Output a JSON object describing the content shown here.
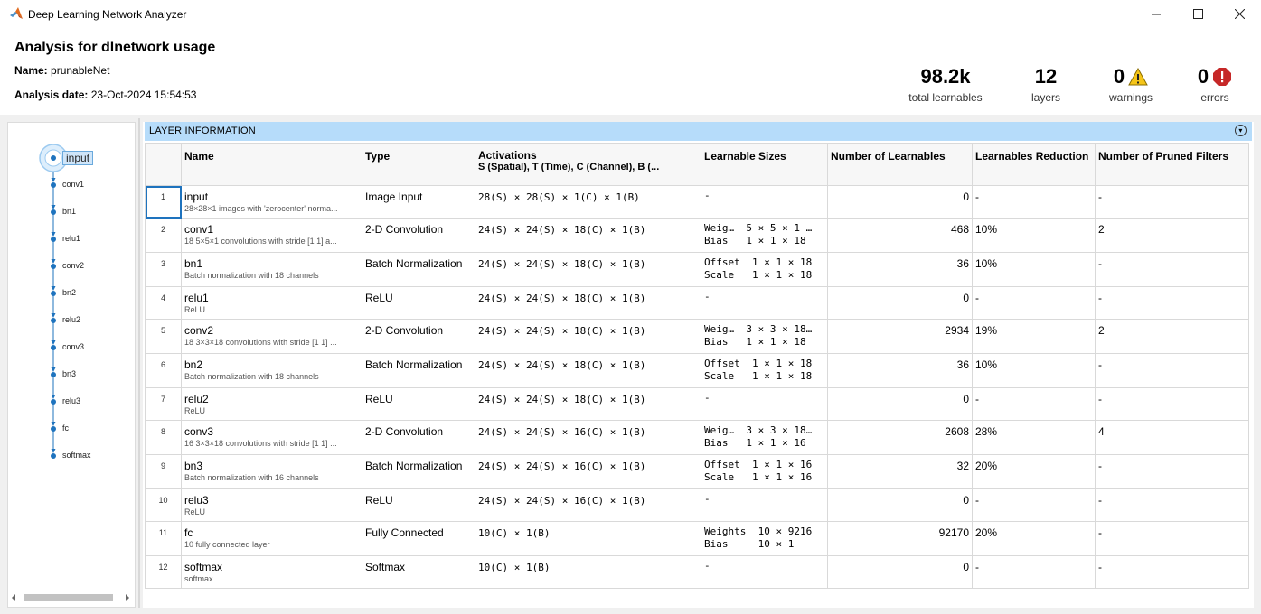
{
  "window": {
    "title": "Deep Learning Network Analyzer"
  },
  "summary": {
    "title": "Analysis for dlnetwork usage",
    "name_label": "Name:",
    "name_value": "prunableNet",
    "date_label": "Analysis date:",
    "date_value": "23-Oct-2024 15:54:53",
    "stats": {
      "learnables": {
        "value": "98.2k",
        "label": "total learnables"
      },
      "layers": {
        "value": "12",
        "label": "layers"
      },
      "warnings": {
        "value": "0",
        "label": "warnings"
      },
      "errors": {
        "value": "0",
        "label": "errors"
      }
    }
  },
  "graph": {
    "nodes": [
      "input",
      "conv1",
      "bn1",
      "relu1",
      "conv2",
      "bn2",
      "relu2",
      "conv3",
      "bn3",
      "relu3",
      "fc",
      "softmax"
    ],
    "selected": "input"
  },
  "panel": {
    "header": "LAYER INFORMATION"
  },
  "table": {
    "columns": {
      "name": "Name",
      "type": "Type",
      "activations": "Activations",
      "activations_sub": "S (Spatial), T (Time), C (Channel), B (...",
      "learnable_sizes": "Learnable Sizes",
      "num_learnables": "Number of Learnables",
      "reduction": "Learnables Reduction",
      "pruned": "Number of Pruned Filters"
    },
    "rows": [
      {
        "idx": "1",
        "name": "input",
        "desc": "28×28×1 images with 'zerocenter' norma...",
        "type": "Image Input",
        "act": "28(S) × 28(S) × 1(C) × 1(B)",
        "ls1": "-",
        "ls2": "",
        "num": "0",
        "red": "-",
        "pruned": "-"
      },
      {
        "idx": "2",
        "name": "conv1",
        "desc": "18 5×5×1 convolutions with stride [1 1] a...",
        "type": "2-D Convolution",
        "act": "24(S) × 24(S) × 18(C) × 1(B)",
        "ls1": "Weig…  5 × 5 × 1 …",
        "ls2": "Bias   1 × 1 × 18",
        "num": "468",
        "red": "10%",
        "pruned": "2"
      },
      {
        "idx": "3",
        "name": "bn1",
        "desc": "Batch normalization with 18 channels",
        "type": "Batch Normalization",
        "act": "24(S) × 24(S) × 18(C) × 1(B)",
        "ls1": "Offset  1 × 1 × 18",
        "ls2": "Scale   1 × 1 × 18",
        "num": "36",
        "red": "10%",
        "pruned": "-"
      },
      {
        "idx": "4",
        "name": "relu1",
        "desc": "ReLU",
        "type": "ReLU",
        "act": "24(S) × 24(S) × 18(C) × 1(B)",
        "ls1": "-",
        "ls2": "",
        "num": "0",
        "red": "-",
        "pruned": "-"
      },
      {
        "idx": "5",
        "name": "conv2",
        "desc": "18 3×3×18 convolutions with stride [1 1] ...",
        "type": "2-D Convolution",
        "act": "24(S) × 24(S) × 18(C) × 1(B)",
        "ls1": "Weig…  3 × 3 × 18…",
        "ls2": "Bias   1 × 1 × 18",
        "num": "2934",
        "red": "19%",
        "pruned": "2"
      },
      {
        "idx": "6",
        "name": "bn2",
        "desc": "Batch normalization with 18 channels",
        "type": "Batch Normalization",
        "act": "24(S) × 24(S) × 18(C) × 1(B)",
        "ls1": "Offset  1 × 1 × 18",
        "ls2": "Scale   1 × 1 × 18",
        "num": "36",
        "red": "10%",
        "pruned": "-"
      },
      {
        "idx": "7",
        "name": "relu2",
        "desc": "ReLU",
        "type": "ReLU",
        "act": "24(S) × 24(S) × 18(C) × 1(B)",
        "ls1": "-",
        "ls2": "",
        "num": "0",
        "red": "-",
        "pruned": "-"
      },
      {
        "idx": "8",
        "name": "conv3",
        "desc": "16 3×3×18 convolutions with stride [1 1] ...",
        "type": "2-D Convolution",
        "act": "24(S) × 24(S) × 16(C) × 1(B)",
        "ls1": "Weig…  3 × 3 × 18…",
        "ls2": "Bias   1 × 1 × 16",
        "num": "2608",
        "red": "28%",
        "pruned": "4"
      },
      {
        "idx": "9",
        "name": "bn3",
        "desc": "Batch normalization with 16 channels",
        "type": "Batch Normalization",
        "act": "24(S) × 24(S) × 16(C) × 1(B)",
        "ls1": "Offset  1 × 1 × 16",
        "ls2": "Scale   1 × 1 × 16",
        "num": "32",
        "red": "20%",
        "pruned": "-"
      },
      {
        "idx": "10",
        "name": "relu3",
        "desc": "ReLU",
        "type": "ReLU",
        "act": "24(S) × 24(S) × 16(C) × 1(B)",
        "ls1": "-",
        "ls2": "",
        "num": "0",
        "red": "-",
        "pruned": "-"
      },
      {
        "idx": "11",
        "name": "fc",
        "desc": "10 fully connected layer",
        "type": "Fully Connected",
        "act": "10(C) × 1(B)",
        "ls1": "Weights  10 × 9216",
        "ls2": "Bias     10 × 1",
        "num": "92170",
        "red": "20%",
        "pruned": "-"
      },
      {
        "idx": "12",
        "name": "softmax",
        "desc": "softmax",
        "type": "Softmax",
        "act": "10(C) × 1(B)",
        "ls1": "-",
        "ls2": "",
        "num": "0",
        "red": "-",
        "pruned": "-"
      }
    ]
  },
  "colors": {
    "accent": "#1e73be",
    "header_bg": "#b6dcfa",
    "warning": "#f5c518",
    "error": "#c62828"
  }
}
